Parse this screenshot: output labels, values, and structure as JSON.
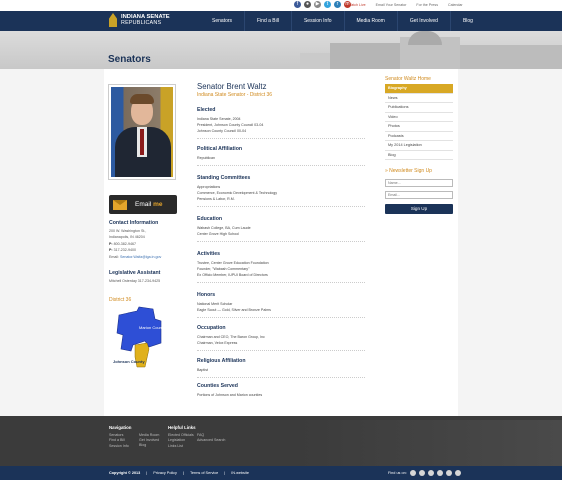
{
  "topbar": {
    "social_icons": [
      "facebook-icon",
      "flickr-icon",
      "youtube-icon",
      "twitter-icon",
      "rss-icon",
      "mobile-icon"
    ],
    "links": [
      "Watch Live",
      "Email Your Senator",
      "For the Press",
      "Calendar"
    ]
  },
  "header": {
    "logo_line1": "INDIANA SENATE",
    "logo_line2": "REPUBLICANS",
    "nav": [
      "Senators",
      "Find a Bill",
      "Session Info",
      "Media Room",
      "Get Involved",
      "Blog"
    ]
  },
  "page_title": "Senators",
  "profile": {
    "name": "Senator Brent Waltz",
    "role": "Indiana State Senator - District 36"
  },
  "email_button": {
    "prefix": "Email",
    "suffix": "me"
  },
  "contact": {
    "heading": "Contact Information",
    "address1": "200 W. Washington St.,",
    "address2": "Indianapolis, IN 46204",
    "phone_label": "P:",
    "phone": "800-382-9467",
    "phone2_label": "P:",
    "phone2": "317-232-9400",
    "email_label": "Email:",
    "email": "Senator.Waltz@iga.in.gov"
  },
  "assistant": {
    "heading": "Legislative Assistant",
    "text": "Mitchell Osterday 317-234-9425"
  },
  "district": {
    "heading": "District 36",
    "label1": "Marion County",
    "label2": "Johnson County"
  },
  "sections": [
    {
      "title": "Elected",
      "lines": [
        "Indiana State Senate, 2004",
        "President, Johnson County Council 03-04",
        "Johnson County Council 00-04"
      ]
    },
    {
      "title": "Political Affiliation",
      "lines": [
        "Republican"
      ]
    },
    {
      "title": "Standing Committees",
      "lines": [
        "Appropriations",
        "Commerce, Economic Development & Technology",
        "Pensions & Labor, R.M."
      ]
    },
    {
      "title": "Education",
      "lines": [
        "Wabash College, BA, Cum Laude",
        "Center Grove High School"
      ]
    },
    {
      "title": "Activities",
      "lines": [
        "Trustee, Center Grove Education Foundation",
        "Founder, \"Wabash Commentary\"",
        "Ex Officio Member, IUPUI Board of Directors"
      ]
    },
    {
      "title": "Honors",
      "lines": [
        "National Merit Scholar",
        "Eagle Scout — Gold, Silver and Bronze Palms"
      ]
    },
    {
      "title": "Occupation",
      "lines": [
        "Chairman and CEO, The Baron Group, Inc",
        "Chairman, Velox Express"
      ]
    },
    {
      "title": "Religious Affiliation",
      "lines": [
        "Baptist"
      ]
    },
    {
      "title": "Counties Served",
      "lines": [
        "Portions of Johnson and Marion counties"
      ]
    }
  ],
  "sidebar": {
    "heading": "Senator Waltz Home",
    "items": [
      "Biography",
      "News",
      "Publications",
      "Video",
      "Photos",
      "Podcasts",
      "My 2014 Legislation",
      "Blog"
    ],
    "newsletter_heading": "» Newsletter Sign Up",
    "name_placeholder": "Name...",
    "email_placeholder": "Email...",
    "signup_label": "Sign Up"
  },
  "footer": {
    "nav_heading": "Navigation",
    "nav_col1": [
      "Senators",
      "Find a Bill",
      "Session Info"
    ],
    "nav_col2": [
      "Media Room",
      "Get Involved",
      "Blog"
    ],
    "links_heading": "Helpful Links",
    "links_col1": [
      "Elected Officials",
      "Legislation",
      "Links List"
    ],
    "links_col2": [
      "FAQ",
      "Advanced Search"
    ],
    "copyright": "Copyright © 2013",
    "bottom_links": [
      "Privacy Policy",
      "Terms of Service",
      "IN.website"
    ],
    "find_us": "Find us on:"
  },
  "colors": {
    "navy": "#1b3358",
    "gold": "#d8a824",
    "orange_text": "#d08a1e"
  }
}
